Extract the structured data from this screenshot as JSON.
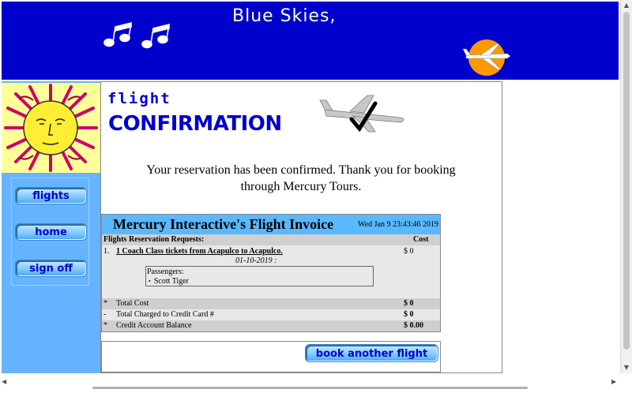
{
  "header": {
    "title": "Blue Skies,"
  },
  "nav": {
    "flights": "flights",
    "home": "home",
    "signoff": "sign off"
  },
  "page": {
    "heading_small": "flight",
    "heading_large": "CONFIRMATION",
    "message": "Your reservation has been confirmed. Thank you for booking through Mercury Tours."
  },
  "invoice": {
    "title": "Mercury Interactive's Flight Invoice",
    "date": "Wed Jan 9 23:43:46 2019",
    "col_requests": "Flights Reservation Requests:",
    "col_cost": "Cost",
    "item_num": "1.",
    "item_desc": "1 Coach Class tickets from Acapulco to Acapulco.",
    "item_date": "01-10-2019 :",
    "item_cost": "$ 0",
    "passengers_label": "Passengers:",
    "passengers": [
      "Scott Tiger"
    ],
    "totals": [
      {
        "mark": "*",
        "label": "Total Cost",
        "value": "$ 0"
      },
      {
        "mark": "-",
        "label": "Total Charged to Credit Card #",
        "value": "$ 0"
      },
      {
        "mark": "*",
        "label": "Credit Account Balance",
        "value": "$ 0.00"
      }
    ]
  },
  "actions": {
    "book_another": "book another flight"
  },
  "colors": {
    "header_blue": "#0000cc",
    "sidebar_blue": "#66b3ff",
    "invoice_header": "#5ab8ff"
  }
}
